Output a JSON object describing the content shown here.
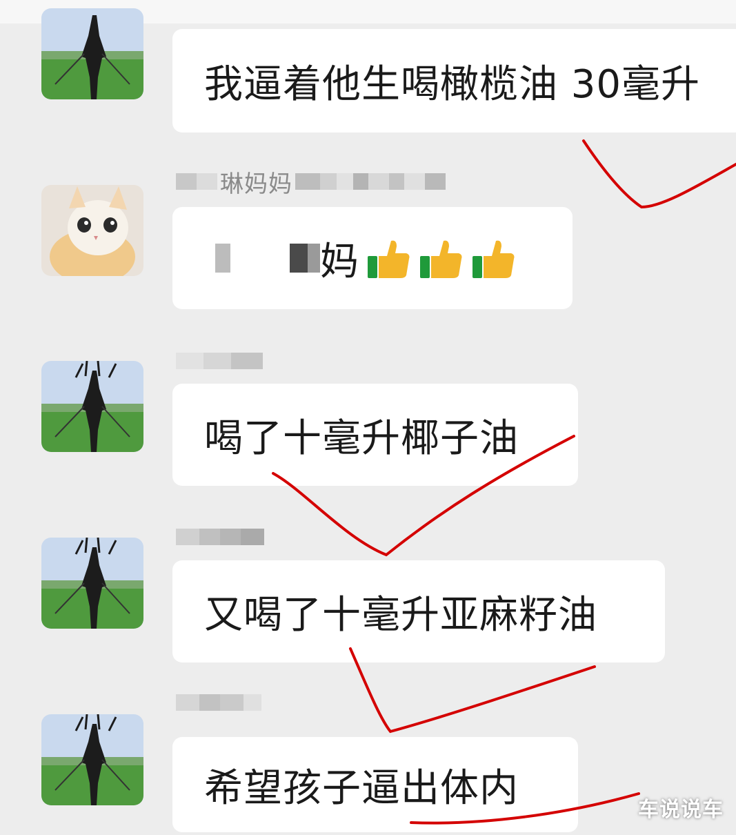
{
  "messages": [
    {
      "text": "我逼着他生喝橄榄油 30毫升"
    },
    {
      "sender_visible": "琳妈妈",
      "text_visible": "妈"
    },
    {
      "text": "喝了十毫升椰子油"
    },
    {
      "text": "又喝了十毫升亚麻籽油"
    },
    {
      "text": "希望孩子逼出体内"
    }
  ],
  "icons": {
    "thumbs": [
      "thumbs-up-icon",
      "thumbs-up-icon",
      "thumbs-up-icon"
    ]
  },
  "colors": {
    "background": "#ededed",
    "bubble": "#ffffff",
    "annotation": "#d40000"
  },
  "watermark": "车说说车"
}
